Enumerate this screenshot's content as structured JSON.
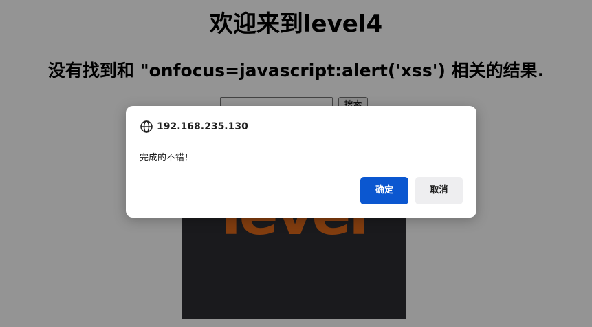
{
  "page": {
    "title": "欢迎来到level4",
    "result_heading": "没有找到和 \"onfocus=javascript:alert('xss') 相关的结果.",
    "search": {
      "value": "",
      "button_label": "搜索"
    },
    "level_image": {
      "logo_text": "level"
    }
  },
  "dialog": {
    "origin": "192.168.235.130",
    "origin_icon": "globe-icon",
    "message": "完成的不错！",
    "ok_label": "确定",
    "cancel_label": "取消"
  },
  "colors": {
    "accent": "#0b57d0",
    "logo_orange": "#e0691a",
    "image_bg": "#2e2d33"
  }
}
